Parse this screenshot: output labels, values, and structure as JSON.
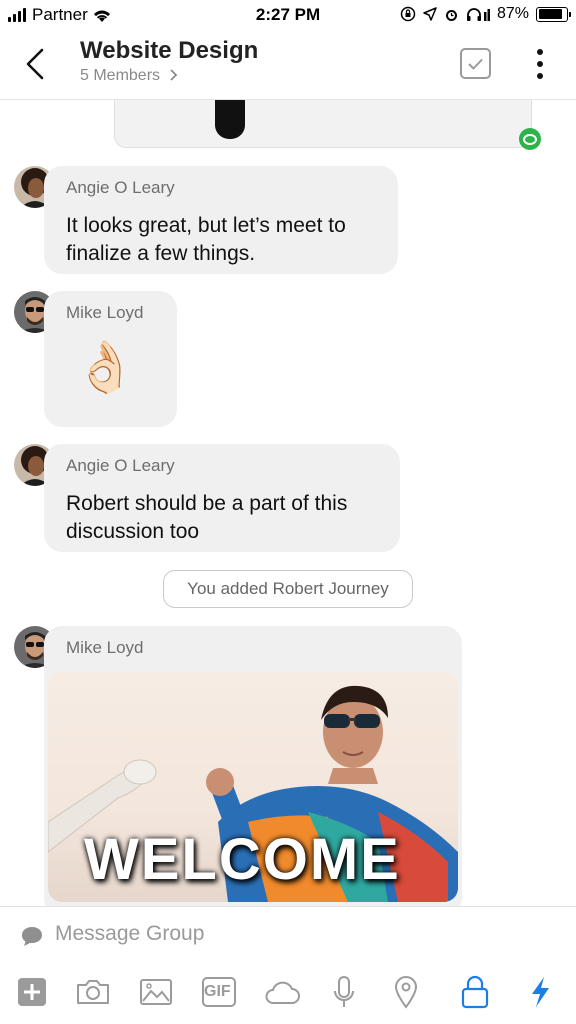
{
  "status_bar": {
    "carrier": "Partner",
    "time": "2:27 PM",
    "battery": "87%",
    "battery_level": 0.87
  },
  "header": {
    "title": "Website Design",
    "members": "5 Members",
    "icons": [
      "chevron-left-icon",
      "task-check-icon",
      "more-vertical-icon"
    ]
  },
  "messages": [
    {
      "sender": "Angie O Leary",
      "text": "It looks great, but let’s meet to finalize a few things."
    },
    {
      "sender": "Mike Loyd",
      "emoji": "👌🏻"
    },
    {
      "sender": "Angie O Leary",
      "text": "Robert should be a part of this discussion too"
    },
    {
      "system": "You added Robert Journey"
    },
    {
      "sender": "Mike Loyd",
      "gif_text": "WELCOME"
    }
  ],
  "compose": {
    "placeholder": "Message Group"
  },
  "toolbar": {
    "gif_label": "GIF",
    "icons": [
      "plus-icon",
      "camera-icon",
      "image-icon",
      "gif-icon",
      "cloud-icon",
      "microphone-icon",
      "location-pin-icon",
      "lock-icon",
      "lightning-icon"
    ],
    "active_color": "#1a7ee6"
  },
  "colors": {
    "bubble": "#f0f0f0",
    "seen_indicator": "#2db34a",
    "accent": "#1a7ee6"
  }
}
